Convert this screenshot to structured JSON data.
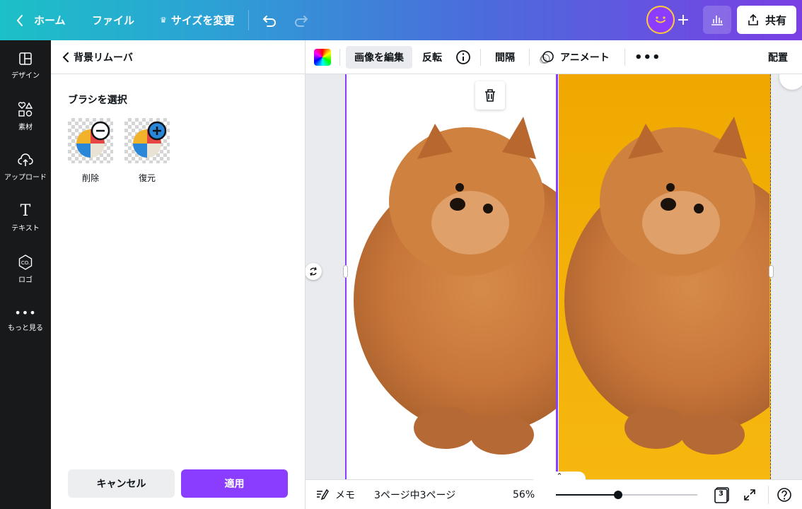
{
  "topbar": {
    "home": "ホーム",
    "file": "ファイル",
    "resize": "サイズを変更",
    "share": "共有"
  },
  "rail": [
    {
      "label": "デザイン",
      "icon": "layout-icon"
    },
    {
      "label": "素材",
      "icon": "elements-icon"
    },
    {
      "label": "アップロード",
      "icon": "upload-icon"
    },
    {
      "label": "テキスト",
      "icon": "text-icon"
    },
    {
      "label": "ロゴ",
      "icon": "logo-icon"
    },
    {
      "label": "もっと見る",
      "icon": "more-icon"
    }
  ],
  "panel": {
    "title": "背景リムーバ",
    "brush_heading": "ブラシを選択",
    "brushes": [
      {
        "label": "削除",
        "icon": "minus-icon"
      },
      {
        "label": "復元",
        "icon": "plus-icon"
      }
    ],
    "cancel": "キャンセル",
    "apply": "適用"
  },
  "toolbar": {
    "edit_image": "画像を編集",
    "flip": "反転",
    "spacing": "間隔",
    "animate": "アニメート",
    "position": "配置"
  },
  "bottom": {
    "notes": "メモ",
    "page_indicator": "3ページ中3ページ",
    "zoom": "56%",
    "zoom_fraction": 0.44,
    "page_count": "3"
  },
  "colors": {
    "accent": "#8b3dff",
    "background_yellow": "#f3b20a"
  }
}
